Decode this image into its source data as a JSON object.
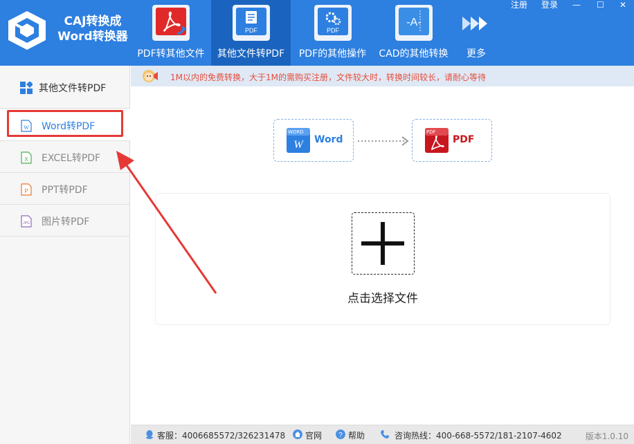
{
  "app": {
    "title_line1": "CAJ转换成",
    "title_line2": "Word转换器"
  },
  "nav": {
    "tabs": [
      {
        "label": "PDF转其他文件",
        "icon": "pdf-icon"
      },
      {
        "label": "其他文件转PDF",
        "icon": "doc-to-pdf-icon",
        "active": true
      },
      {
        "label": "PDF的其他操作",
        "icon": "gear-pdf-icon"
      },
      {
        "label": "CAD的其他转换",
        "icon": "cad-icon"
      },
      {
        "label": "更多",
        "icon": "more-arrows-icon"
      }
    ]
  },
  "window": {
    "register": "注册",
    "login": "登录",
    "minimize_glyph": "—",
    "maximize_glyph": "☐",
    "close_glyph": "✕"
  },
  "sidebar": {
    "header": "其他文件转PDF",
    "items": [
      {
        "label": "Word转PDF",
        "icon": "word-file-icon",
        "active": true
      },
      {
        "label": "EXCEL转PDF",
        "icon": "excel-file-icon"
      },
      {
        "label": "PPT转PDF",
        "icon": "ppt-file-icon"
      },
      {
        "label": "图片转PDF",
        "icon": "jpg-file-icon"
      }
    ]
  },
  "notice": {
    "text": "1M以内的免费转换，大于1M的需购买注册，文件较大时，转换时间较长，请耐心等待"
  },
  "conversion": {
    "from": "Word",
    "to": "PDF",
    "from_badge": "WORD",
    "to_badge": "PDF"
  },
  "drop_zone": {
    "label": "点击选择文件"
  },
  "footer": {
    "service": "客服：4006685572/326231478",
    "website": "官网",
    "help": "帮助",
    "hotline": "咨询热线：400-668-5572/181-2107-4602",
    "version": "版本1.0.10"
  },
  "colors": {
    "header_blue": "#2d7fe0",
    "active_tab": "#1a64bf",
    "notice_red": "#e74c3c",
    "highlight_red": "#e53935"
  }
}
